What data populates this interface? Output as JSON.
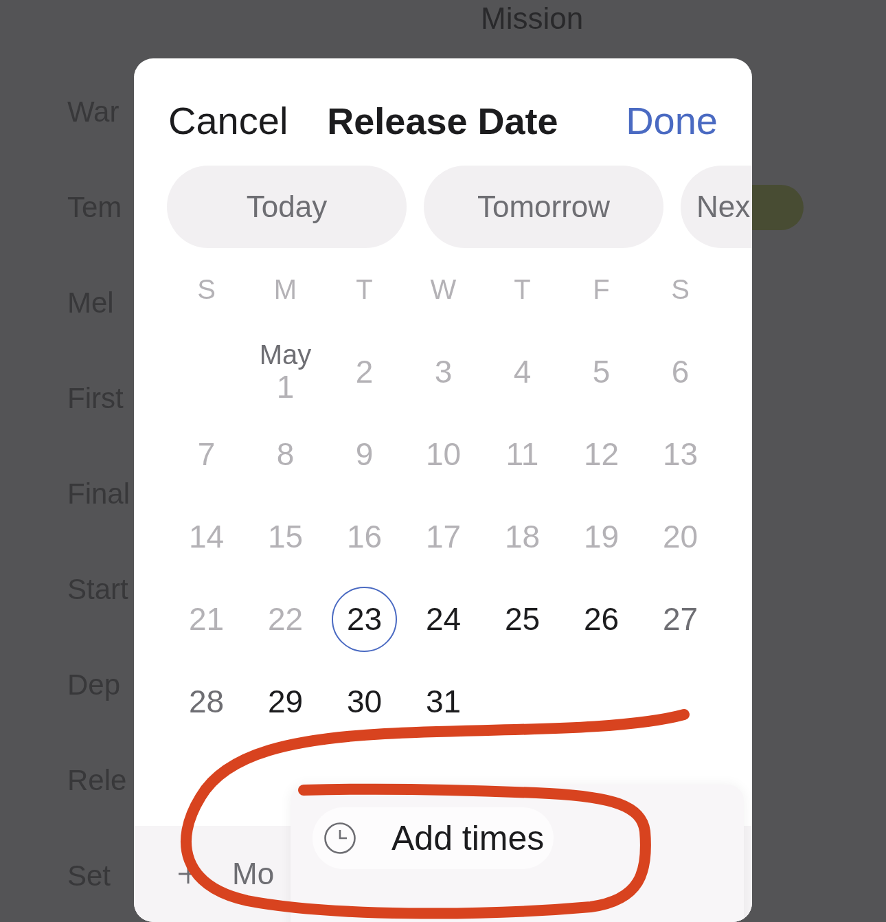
{
  "background": {
    "title": "Mission",
    "rows": [
      {
        "label": "War",
        "status_pill": false
      },
      {
        "label": "Tem",
        "status_pill": true
      },
      {
        "label": "Mel",
        "status_pill": false
      },
      {
        "label": "First",
        "status_pill": false
      },
      {
        "label": "Final",
        "status_pill": false
      },
      {
        "label": "Start",
        "status_pill": false
      },
      {
        "label": "Dep",
        "status_pill": false
      },
      {
        "label": "Rele",
        "status_pill": false
      },
      {
        "label": "Set",
        "status_pill": false
      }
    ]
  },
  "dialog": {
    "cancel": "Cancel",
    "title": "Release Date",
    "done": "Done",
    "quick_picks": [
      {
        "label": "Today"
      },
      {
        "label": "Tomorrow"
      },
      {
        "label": "Nex"
      }
    ],
    "weekdays": [
      "S",
      "M",
      "T",
      "W",
      "T",
      "F",
      "S"
    ],
    "weeks": [
      [
        {
          "label": "1",
          "month": "May",
          "disabled": true,
          "selected": false
        },
        {
          "label": "2",
          "disabled": true,
          "selected": false
        },
        {
          "label": "3",
          "disabled": true,
          "selected": false
        },
        {
          "label": "4",
          "disabled": true,
          "selected": false
        },
        {
          "label": "5",
          "disabled": true,
          "selected": false
        },
        {
          "label": "6",
          "disabled": true,
          "selected": false
        }
      ],
      [
        {
          "label": "7",
          "disabled": true,
          "selected": false
        },
        {
          "label": "8",
          "disabled": true,
          "selected": false
        },
        {
          "label": "9",
          "disabled": true,
          "selected": false
        },
        {
          "label": "10",
          "disabled": true,
          "selected": false
        },
        {
          "label": "11",
          "disabled": true,
          "selected": false
        },
        {
          "label": "12",
          "disabled": true,
          "selected": false
        },
        {
          "label": "13",
          "disabled": true,
          "selected": false
        }
      ],
      [
        {
          "label": "14",
          "disabled": true,
          "selected": false
        },
        {
          "label": "15",
          "disabled": true,
          "selected": false
        },
        {
          "label": "16",
          "disabled": true,
          "selected": false
        },
        {
          "label": "17",
          "disabled": true,
          "selected": false
        },
        {
          "label": "18",
          "disabled": true,
          "selected": false
        },
        {
          "label": "19",
          "disabled": true,
          "selected": false
        },
        {
          "label": "20",
          "disabled": true,
          "selected": false
        }
      ],
      [
        {
          "label": "21",
          "disabled": true,
          "selected": false
        },
        {
          "label": "22",
          "disabled": true,
          "selected": false
        },
        {
          "label": "23",
          "disabled": false,
          "selected": true
        },
        {
          "label": "24",
          "disabled": false,
          "selected": false
        },
        {
          "label": "25",
          "disabled": false,
          "selected": false
        },
        {
          "label": "26",
          "disabled": false,
          "selected": false
        },
        {
          "label": "27",
          "disabled": false,
          "selected": false
        }
      ],
      [
        {
          "label": "28",
          "disabled": false,
          "selected": false
        },
        {
          "label": "29",
          "disabled": false,
          "selected": false
        },
        {
          "label": "30",
          "disabled": false,
          "selected": false
        },
        {
          "label": "31",
          "disabled": false,
          "selected": false
        }
      ]
    ],
    "toolbar": {
      "more": "Mo"
    },
    "popover": {
      "item": "Add times"
    }
  }
}
